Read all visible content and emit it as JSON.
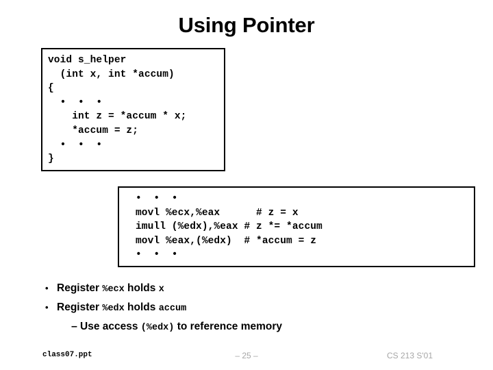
{
  "slide": {
    "title": "Using Pointer"
  },
  "c_code_box": {
    "name": "c-source-code",
    "text": "void s_helper\n  (int x, int *accum)\n{\n  •  •  •\n    int z = *accum * x;\n    *accum = z;\n  •  •  •\n}"
  },
  "asm_code_box": {
    "name": "assembly-code",
    "text": "•  •  •\nmovl %ecx,%eax      # z = x\nimull (%edx),%eax # z *= *accum\nmovl %eax,(%edx)  # *accum = z\n•  •  •"
  },
  "bullets": [
    {
      "level": 1,
      "marker": "•",
      "runs": [
        {
          "text": "Register ",
          "mono": false
        },
        {
          "text": "%ecx",
          "mono": true
        },
        {
          "text": " holds ",
          "mono": false
        },
        {
          "text": "x",
          "mono": true
        }
      ]
    },
    {
      "level": 1,
      "marker": "•",
      "runs": [
        {
          "text": "Register ",
          "mono": false
        },
        {
          "text": "%edx",
          "mono": true
        },
        {
          "text": " holds ",
          "mono": false
        },
        {
          "text": "accum",
          "mono": true
        }
      ]
    },
    {
      "level": 2,
      "marker": "–",
      "runs": [
        {
          "text": "Use access ",
          "mono": false
        },
        {
          "text": "(%edx)",
          "mono": true
        },
        {
          "text": " to reference memory",
          "mono": false
        }
      ]
    }
  ],
  "footer": {
    "file": "class07.ppt",
    "page": "– 25 –",
    "course": "CS 213 S'01"
  },
  "colors": {
    "text": "#000000",
    "footer_muted": "#a6a6a6",
    "border": "#000000",
    "background": "#ffffff"
  }
}
